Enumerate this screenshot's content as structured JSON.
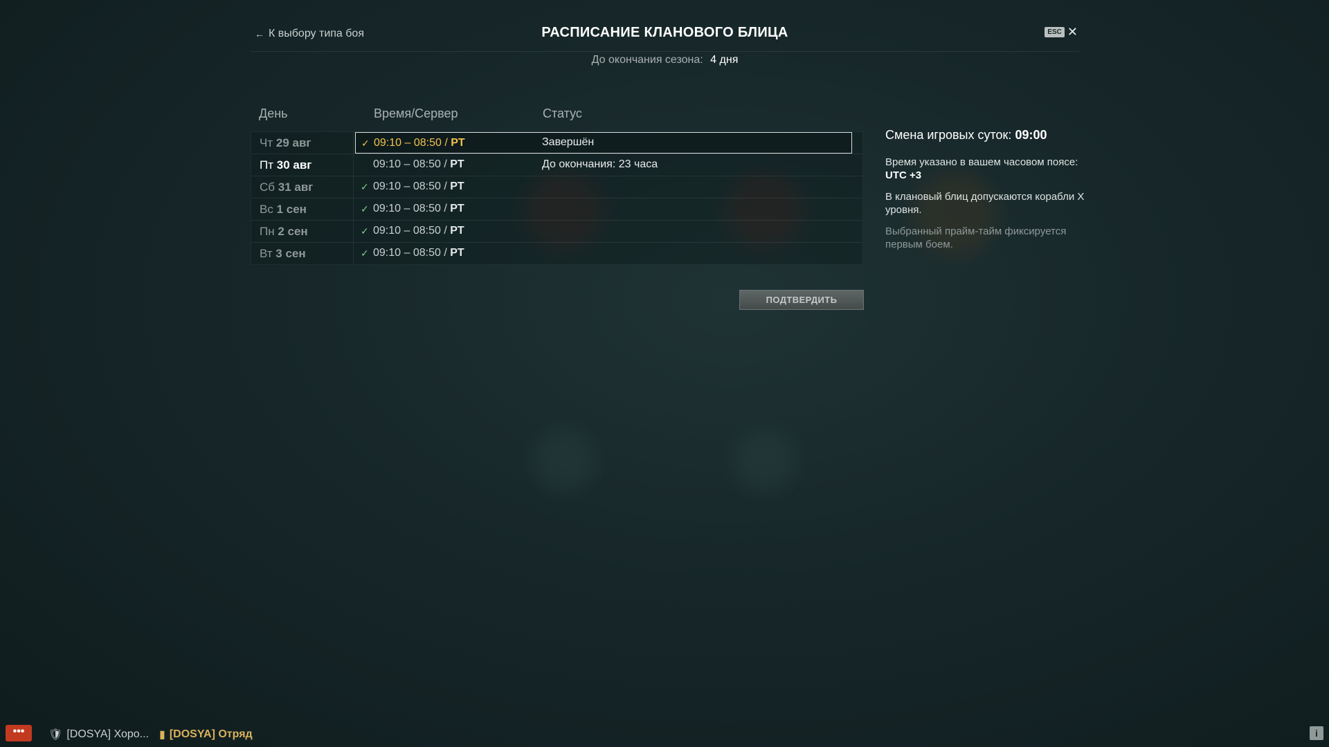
{
  "header": {
    "back_label": "К выбору типа боя",
    "title": "РАСПИСАНИЕ КЛАНОВОГО БЛИЦА",
    "esc_label": "ESC",
    "close_glyph": "✕"
  },
  "season": {
    "label": "До окончания сезона:",
    "value": "4 дня"
  },
  "table": {
    "headers": {
      "day": "День",
      "time": "Время/Сервер",
      "status": "Статус"
    },
    "rows": [
      {
        "weekday": "Чт",
        "date": "29 авг",
        "time": "09:10 – 08:50 / ",
        "server": "PT",
        "status": "Завершён",
        "checked": true,
        "state": "selected"
      },
      {
        "weekday": "Пт",
        "date": "30 авг",
        "time": "09:10 – 08:50 / ",
        "server": "PT",
        "status": "До окончания: 23 часа",
        "checked": false,
        "state": "current"
      },
      {
        "weekday": "Сб",
        "date": "31 авг",
        "time": "09:10 – 08:50 / ",
        "server": "PT",
        "status": "",
        "checked": true,
        "state": "normal"
      },
      {
        "weekday": "Вс",
        "date": "1 сен",
        "time": "09:10 – 08:50 / ",
        "server": "PT",
        "status": "",
        "checked": true,
        "state": "normal"
      },
      {
        "weekday": "Пн",
        "date": "2 сен",
        "time": "09:10 – 08:50 / ",
        "server": "PT",
        "status": "",
        "checked": true,
        "state": "normal"
      },
      {
        "weekday": "Вт",
        "date": "3 сен",
        "time": "09:10 – 08:50 / ",
        "server": "PT",
        "status": "",
        "checked": true,
        "state": "normal"
      }
    ]
  },
  "confirm_label": "ПОДТВЕРДИТЬ",
  "info": {
    "day_change_label": "Смена игровых суток:",
    "day_change_value": "09:00",
    "timezone_text": "Время указано в вашем часовом поясе:",
    "timezone_value": "UTC +3",
    "ships_text": "В клановый блиц допускаются корабли X уровня.",
    "primetime_text": "Выбранный прайм-тайм фиксируется первым боем."
  },
  "bottom": {
    "chat_glyph": "•••",
    "clan_label": "[DOSYA] Хоро...",
    "squad_label": "[DOSYA] Отряд",
    "info_glyph": "i"
  },
  "colors": {
    "accent_selected": "#f2c24e",
    "check": "#7fcf8a",
    "chat_button": "#c23a20"
  },
  "icons": [
    "back-arrow-icon",
    "esc-close-icon",
    "check-icon",
    "chat-icon",
    "clan-shield-icon",
    "squad-icon",
    "info-icon"
  ]
}
